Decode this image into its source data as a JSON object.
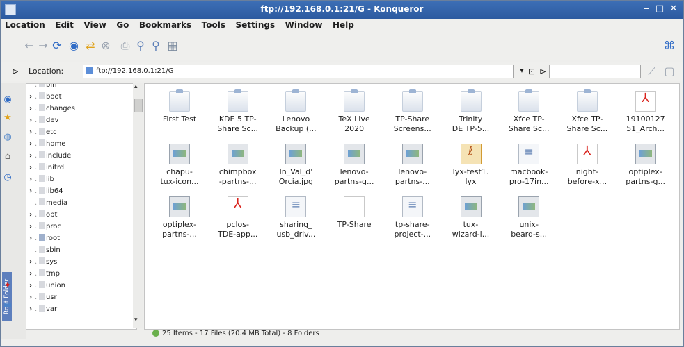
{
  "window": {
    "title": "ftp://192.168.0.1:21/G - Konqueror"
  },
  "menu": [
    "Location",
    "Edit",
    "View",
    "Go",
    "Bookmarks",
    "Tools",
    "Settings",
    "Window",
    "Help"
  ],
  "location": {
    "label": "Location:",
    "url": "ftp://192.168.0.1:21/G",
    "search_placeholder": ""
  },
  "sidebar_tab": "Root Folder",
  "tree": [
    {
      "label": "bin",
      "arrow": false
    },
    {
      "label": "boot",
      "arrow": true
    },
    {
      "label": "changes",
      "arrow": true
    },
    {
      "label": "dev",
      "arrow": true
    },
    {
      "label": "etc",
      "arrow": true
    },
    {
      "label": "home",
      "arrow": true
    },
    {
      "label": "include",
      "arrow": true
    },
    {
      "label": "initrd",
      "arrow": true
    },
    {
      "label": "lib",
      "arrow": true
    },
    {
      "label": "lib64",
      "arrow": true
    },
    {
      "label": "media",
      "arrow": false
    },
    {
      "label": "opt",
      "arrow": true
    },
    {
      "label": "proc",
      "arrow": true
    },
    {
      "label": "root",
      "arrow": true
    },
    {
      "label": "sbin",
      "arrow": false
    },
    {
      "label": "sys",
      "arrow": true
    },
    {
      "label": "tmp",
      "arrow": true
    },
    {
      "label": "union",
      "arrow": true
    },
    {
      "label": "usr",
      "arrow": true
    },
    {
      "label": "var",
      "arrow": true
    }
  ],
  "files": [
    {
      "line1": "First Test",
      "line2": "",
      "icon": "folder"
    },
    {
      "line1": "KDE 5 TP-",
      "line2": "Share Sc...",
      "icon": "folder"
    },
    {
      "line1": "Lenovo",
      "line2": "Backup (...",
      "icon": "folder"
    },
    {
      "line1": "TeX Live",
      "line2": "2020",
      "icon": "folder"
    },
    {
      "line1": "TP-Share",
      "line2": "Screens...",
      "icon": "folder"
    },
    {
      "line1": "Trinity",
      "line2": "DE TP-5...",
      "icon": "folder"
    },
    {
      "line1": "Xfce TP-",
      "line2": "Share Sc...",
      "icon": "folder"
    },
    {
      "line1": "Xfce TP-",
      "line2": "Share Sc...",
      "icon": "folder"
    },
    {
      "line1": "19100127",
      "line2": "51_Arch...",
      "icon": "pdf"
    },
    {
      "line1": "chapu-",
      "line2": "tux-icon...",
      "icon": "img"
    },
    {
      "line1": "chimpbox",
      "line2": "-partns-...",
      "icon": "img"
    },
    {
      "line1": "In_Val_d'",
      "line2": "Orcia.jpg",
      "icon": "img"
    },
    {
      "line1": "lenovo-",
      "line2": "partns-g...",
      "icon": "img"
    },
    {
      "line1": "lenovo-",
      "line2": "partns-...",
      "icon": "img"
    },
    {
      "line1": "lyx-test1.",
      "line2": "lyx",
      "icon": "lyx"
    },
    {
      "line1": "macbook-",
      "line2": "pro-17in...",
      "icon": "doc"
    },
    {
      "line1": "night-",
      "line2": "before-x...",
      "icon": "pdf"
    },
    {
      "line1": "optiplex-",
      "line2": "partns-g...",
      "icon": "img"
    },
    {
      "line1": "optiplex-",
      "line2": "partns-...",
      "icon": "img"
    },
    {
      "line1": "pclos-",
      "line2": "TDE-app...",
      "icon": "pdf"
    },
    {
      "line1": "sharing_",
      "line2": "usb_driv...",
      "icon": "doc"
    },
    {
      "line1": "TP-Share",
      "line2": "",
      "icon": "blank"
    },
    {
      "line1": "tp-share-",
      "line2": "project-...",
      "icon": "doc"
    },
    {
      "line1": "tux-",
      "line2": "wizard-i...",
      "icon": "img"
    },
    {
      "line1": "unix-",
      "line2": "beard-s...",
      "icon": "img"
    }
  ],
  "status": "25 Items - 17 Files (20.4 MB Total) - 8 Folders",
  "colors": {
    "titlebar": "#2c5aa0",
    "accent": "#5c8ed8",
    "pdf": "#d9221c"
  }
}
